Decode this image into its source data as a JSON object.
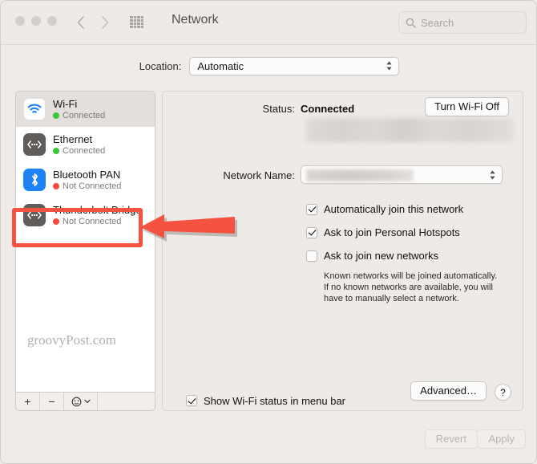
{
  "window": {
    "title": "Network",
    "traffic_lights": [
      "close",
      "minimize",
      "zoom"
    ],
    "accent_red": "#f5533f"
  },
  "toolbar": {
    "back_icon": "chevron-left-icon",
    "forward_icon": "chevron-right-icon",
    "grid_icon": "grid-apps-icon",
    "search": {
      "placeholder": "Search",
      "value": "",
      "icon": "search-icon"
    }
  },
  "location": {
    "label": "Location:",
    "value": "Automatic",
    "options": [
      "Automatic"
    ],
    "stepper_icon": "up-down-chevron-icon"
  },
  "sidebar": {
    "services": [
      {
        "name": "Wi-Fi",
        "status": "Connected",
        "status_color": "#3dc63d",
        "icon": "wifi-icon",
        "selected": true,
        "highlighted": false
      },
      {
        "name": "Ethernet",
        "status": "Connected",
        "status_color": "#3dc63d",
        "icon": "ethernet-icon",
        "selected": false,
        "highlighted": true
      },
      {
        "name": "Bluetooth PAN",
        "status": "Not Connected",
        "status_color": "#f84b3c",
        "icon": "bluetooth-icon",
        "selected": false,
        "highlighted": false
      },
      {
        "name": "Thunderbolt Bridge",
        "status": "Not Connected",
        "status_color": "#f84b3c",
        "icon": "thunderbolt-icon",
        "selected": false,
        "highlighted": false
      }
    ],
    "watermark": "groovyPost.com",
    "toolbar": {
      "add_label": "+",
      "remove_label": "−",
      "action_icon": "gear-action-icon",
      "action_chevron": "chevron-down-icon"
    }
  },
  "panel": {
    "status_label": "Status:",
    "status_value": "Connected",
    "turn_off_button": "Turn Wi-Fi Off",
    "status_detail_redacted": true,
    "network_name_label": "Network Name:",
    "network_name_value": "",
    "network_name_redacted": true,
    "checkboxes": [
      {
        "label": "Automatically join this network",
        "checked": true
      },
      {
        "label": "Ask to join Personal Hotspots",
        "checked": true
      },
      {
        "label": "Ask to join new networks",
        "checked": false
      }
    ],
    "help_text": "Known networks will be joined automatically. If no known networks are available, you will have to manually select a network.",
    "menubar_checkbox": {
      "label": "Show Wi-Fi status in menu bar",
      "checked": true
    },
    "advanced_button": "Advanced…",
    "help_button": "?"
  },
  "footer": {
    "revert_button": "Revert",
    "apply_button": "Apply",
    "revert_enabled": false,
    "apply_enabled": false
  }
}
